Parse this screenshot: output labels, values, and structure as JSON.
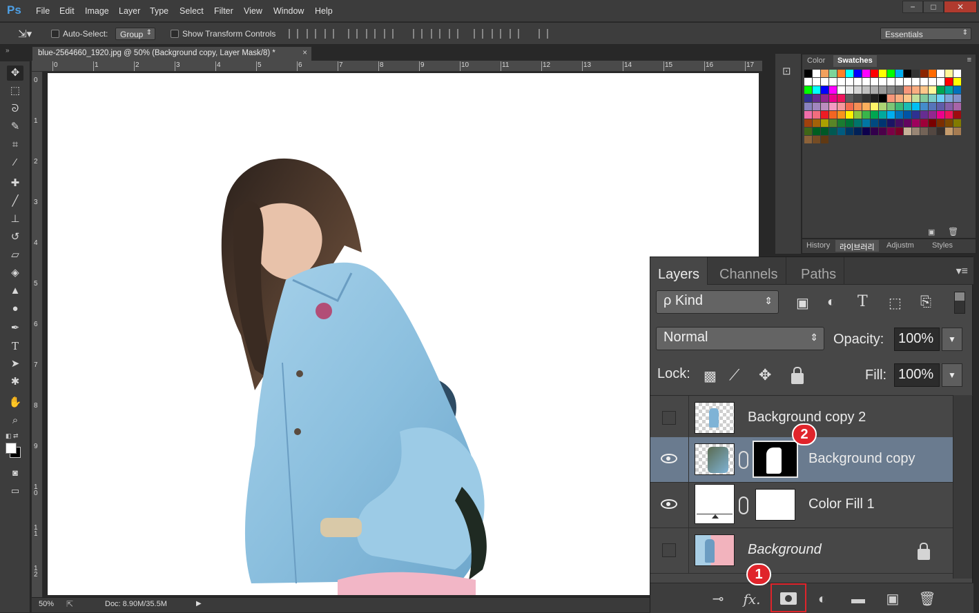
{
  "app": {
    "logo": "Ps"
  },
  "menubar": {
    "items": [
      "File",
      "Edit",
      "Image",
      "Layer",
      "Type",
      "Select",
      "Filter",
      "View",
      "Window",
      "Help"
    ]
  },
  "window_controls": {
    "minimize": "−",
    "maximize": "□",
    "close": "✕"
  },
  "options": {
    "auto_select_label": "Auto-Select:",
    "auto_select_value": "Group",
    "show_transform_label": "Show Transform Controls",
    "workspace": "Essentials"
  },
  "document": {
    "tab_title": "blue-2564660_1920.jpg @ 50% (Background copy, Layer Mask/8) *",
    "close": "×",
    "ruler_top": [
      "0",
      "1",
      "2",
      "3",
      "4",
      "5",
      "6",
      "7",
      "8",
      "9",
      "10",
      "11",
      "12",
      "13",
      "14",
      "15",
      "16",
      "17"
    ],
    "ruler_left": [
      "0",
      "1",
      "2",
      "3",
      "4",
      "5",
      "6",
      "7",
      "8",
      "9",
      "1\n0",
      "1\n1",
      "1\n2"
    ]
  },
  "status": {
    "zoom": "50%",
    "doc_info": "Doc: 8.90M/35.5M"
  },
  "swatch_panel": {
    "tabs": [
      "Color",
      "Swatches"
    ],
    "active_tab": "Swatches",
    "colors": [
      "#000000",
      "#ffffff",
      "#f2a15e",
      "#7ed49a",
      "#ff7f27",
      "#00ffff",
      "#0000ff",
      "#ff00ff",
      "#ff0000",
      "#ffff00",
      "#00ff00",
      "#00aeef",
      "#000000",
      "#333333",
      "#8b2500",
      "#ff6a00",
      "#ffffff",
      "#fff799",
      "#ffffff",
      "#ffffff",
      "#ffffff",
      "#ffffff",
      "#ffffff",
      "#ffffff",
      "#ffffff",
      "#ffffff",
      "#ffffff",
      "#ffffff",
      "#ffffff",
      "#ffffff",
      "#ffffff",
      "#ffffff",
      "#ffffff",
      "#ffffff",
      "#ffffff",
      "#ffffff",
      "#ff0000",
      "#ffff00",
      "#00ff00",
      "#00ffff",
      "#0000ff",
      "#ff00ff",
      "#ffffff",
      "#ebebeb",
      "#d6d6d6",
      "#c2c2c2",
      "#adadad",
      "#999999",
      "#858585",
      "#707070",
      "#f7977a",
      "#f9ad81",
      "#fdc68a",
      "#fff79a",
      "#00a651",
      "#00a99d",
      "#0072bc",
      "#2e3192",
      "#662d91",
      "#92278f",
      "#ec008c",
      "#ed145b",
      "#5c5c5c",
      "#474747",
      "#333333",
      "#1f1f1f",
      "#000000",
      "#f7977a",
      "#f9ad81",
      "#fdc68a",
      "#c4df9b",
      "#82ca9c",
      "#7accc8",
      "#6dcff6",
      "#7ea7d8",
      "#8393ca",
      "#8882be",
      "#a186be",
      "#bc8dbf",
      "#f49ac2",
      "#f6989d",
      "#f26c4f",
      "#f68e55",
      "#fbaf5d",
      "#fff568",
      "#acd373",
      "#7cc576",
      "#3bb878",
      "#1abbb4",
      "#00bff3",
      "#448ccb",
      "#5674b9",
      "#605ca8",
      "#855fa8",
      "#a864a8",
      "#f06eaa",
      "#f26d7d",
      "#ed1c24",
      "#f26522",
      "#f7941d",
      "#fff200",
      "#8dc73f",
      "#39b54a",
      "#00a651",
      "#00a99d",
      "#00aeef",
      "#0072bc",
      "#0054a6",
      "#2e3192",
      "#662d91",
      "#92278f",
      "#ec008c",
      "#ed145b",
      "#9e0b0f",
      "#a0410d",
      "#a36209",
      "#aba000",
      "#598527",
      "#1a7b30",
      "#007236",
      "#00746b",
      "#0076a3",
      "#004a80",
      "#003471",
      "#1b1464",
      "#440e62",
      "#630460",
      "#9e005d",
      "#9e0039",
      "#790000",
      "#7b2e00",
      "#7d4900",
      "#827b00",
      "#406618",
      "#005e20",
      "#005826",
      "#005952",
      "#005b7f",
      "#003663",
      "#002157",
      "#0d004c",
      "#32004b",
      "#4b0049",
      "#7b0046",
      "#7a0026",
      "#c7b299",
      "#998675",
      "#736357",
      "#534741",
      "#37302d",
      "#c69c6d",
      "#a67c52",
      "#8c6239",
      "#754c24",
      "#603913"
    ]
  },
  "lower_panel_tabs": [
    "History",
    "라이브러리",
    "Adjustm",
    "Styles"
  ],
  "layers": {
    "tabs": [
      "Layers",
      "Channels",
      "Paths"
    ],
    "kind_label": "ρ Kind",
    "blend_mode": "Normal",
    "opacity_label": "Opacity:",
    "opacity_value": "100%",
    "lock_label": "Lock:",
    "fill_label": "Fill:",
    "fill_value": "100%",
    "rows": [
      {
        "name": "Background copy 2",
        "visible": false
      },
      {
        "name": "Background copy",
        "visible": true
      },
      {
        "name": "Color Fill 1",
        "visible": true
      },
      {
        "name": "Background",
        "visible": false
      }
    ],
    "bottom_icons": [
      "link-icon",
      "fx-icon",
      "add-mask-icon",
      "adjustment-icon",
      "folder-icon",
      "new-layer-icon",
      "trash-icon"
    ],
    "fx_label": "fx."
  },
  "annotations": {
    "badge_1": "1",
    "badge_2": "2",
    "highlight_color": "#e0242b"
  }
}
